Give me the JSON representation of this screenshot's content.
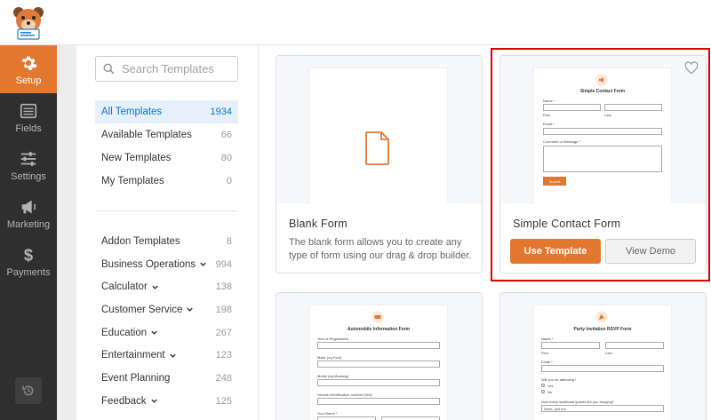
{
  "nav": {
    "items": [
      {
        "label": "Setup",
        "icon": "gear-icon"
      },
      {
        "label": "Fields",
        "icon": "fields-icon"
      },
      {
        "label": "Settings",
        "icon": "sliders-icon"
      },
      {
        "label": "Marketing",
        "icon": "megaphone-icon"
      },
      {
        "label": "Payments",
        "icon": "dollar-icon"
      }
    ]
  },
  "search": {
    "placeholder": "Search Templates"
  },
  "categories": [
    {
      "label": "All Templates",
      "count": "1934"
    },
    {
      "label": "Available Templates",
      "count": "66"
    },
    {
      "label": "New Templates",
      "count": "80"
    },
    {
      "label": "My Templates",
      "count": "0"
    }
  ],
  "categories2": [
    {
      "label": "Addon Templates",
      "count": "8"
    },
    {
      "label": "Business Operations",
      "count": "994"
    },
    {
      "label": "Calculator",
      "count": "138"
    },
    {
      "label": "Customer Service",
      "count": "198"
    },
    {
      "label": "Education",
      "count": "267"
    },
    {
      "label": "Entertainment",
      "count": "123"
    },
    {
      "label": "Event Planning",
      "count": "248"
    },
    {
      "label": "Feedback",
      "count": "125"
    }
  ],
  "cards": {
    "blank": {
      "title": "Blank Form",
      "desc": "The blank form allows you to create any type of form using our drag & drop builder."
    },
    "simple": {
      "title": "Simple Contact Form",
      "use_label": "Use Template",
      "demo_label": "View Demo",
      "preview": {
        "title": "Simple Contact Form",
        "name": "Name *",
        "first": "First",
        "last": "Last",
        "email": "Email *",
        "comment": "Comment or Message *",
        "submit": "Submit"
      }
    },
    "auto": {
      "preview": {
        "title": "Automobile Information Form",
        "f1": "Year of Registration",
        "f2": "Make (eg Ford)",
        "f3": "Model (eg Mustang)",
        "f4": "Vehicle Identification number (VIN)",
        "f5": "Your Name *"
      }
    },
    "party": {
      "preview": {
        "title": "Party Invitation RSVP Form",
        "name": "Name *",
        "first": "First",
        "last": "Last",
        "email": "Email *",
        "attending": "Will you be attending?",
        "yes": "Yes",
        "no": "No",
        "guests": "How many additional guests are you bringing?",
        "guests_value": "None, just me"
      }
    }
  },
  "colors": {
    "accent": "#e27730",
    "active_blue": "#0b73c9",
    "highlight": "#dd0000"
  }
}
